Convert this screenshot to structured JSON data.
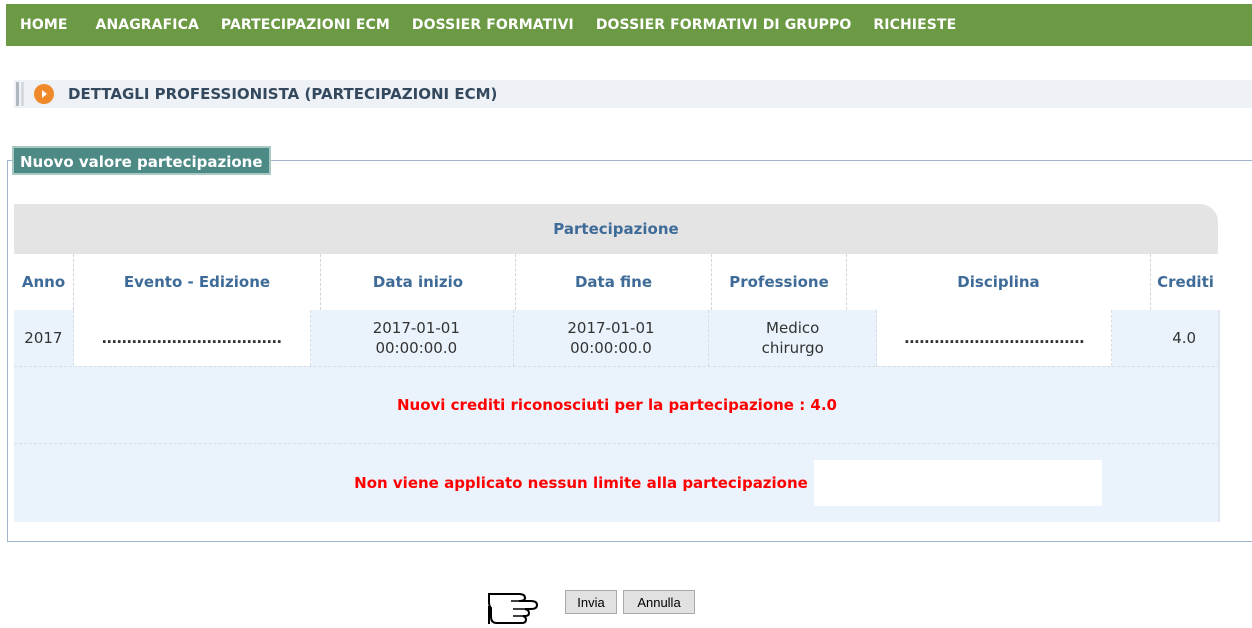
{
  "nav": {
    "items": [
      "HOME",
      "ANAGRAFICA",
      "PARTECIPAZIONI ECM",
      "DOSSIER FORMATIVI",
      "DOSSIER FORMATIVI DI GRUPPO",
      "RICHIESTE"
    ]
  },
  "section": {
    "title": "DETTAGLI PROFESSIONISTA (PARTECIPAZIONI ECM)"
  },
  "form": {
    "legend": "Nuovo valore partecipazione",
    "caption": "Partecipazione",
    "headers": [
      "Anno",
      "Evento - Edizione",
      "Data inizio",
      "Data fine",
      "Professione",
      "Disciplina",
      "Crediti"
    ],
    "row": {
      "anno": "2017",
      "evento": "………………………………",
      "data_inizio_1": "2017-01-01",
      "data_inizio_2": "00:00:00.0",
      "data_fine_1": "2017-01-01",
      "data_fine_2": "00:00:00.0",
      "professione_1": "Medico",
      "professione_2": "chirurgo",
      "disciplina": "………………………………",
      "crediti": "4.0"
    },
    "message_credits": "Nuovi crediti riconosciuti per la partecipazione : 4.0",
    "message_limit": "Non viene applicato nessun limite alla partecipazione"
  },
  "buttons": {
    "submit": "Invia",
    "cancel": "Annulla"
  },
  "colors": {
    "nav_bg": "#6c9a44",
    "legend_bg": "#4d8a85",
    "accent_orange": "#f0892a",
    "alert_red": "#ff0000",
    "header_blue": "#3e6b97"
  },
  "icons": {
    "section": "arrow-right-circle-icon",
    "pointer": "hand-pointer-icon"
  }
}
